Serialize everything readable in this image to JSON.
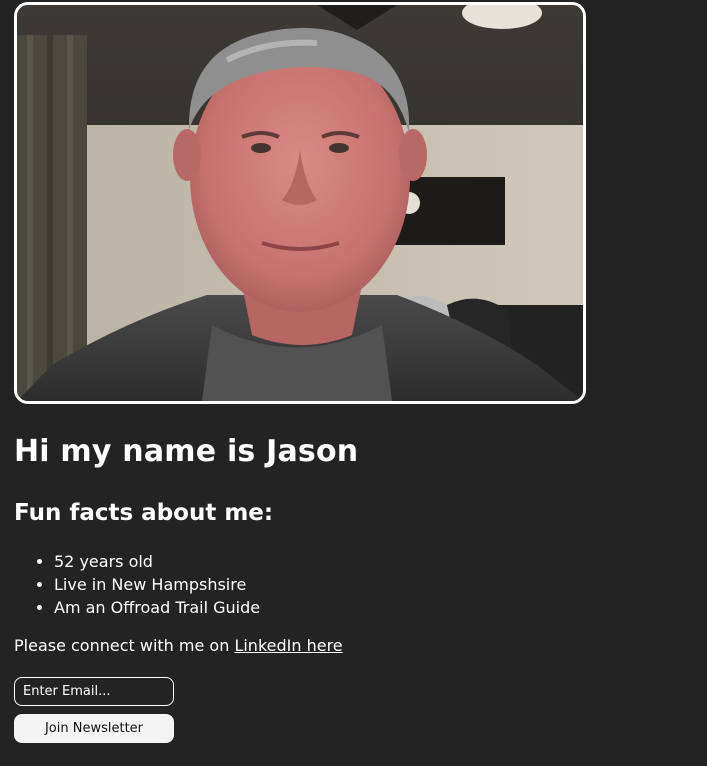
{
  "profile": {
    "photo": "portrait-photo"
  },
  "header": {
    "title": "Hi my name is Jason"
  },
  "facts": {
    "heading": "Fun facts about me:",
    "items": [
      "52 years old",
      "Live in New Hampshsire",
      "Am an Offroad Trail Guide"
    ]
  },
  "connect": {
    "text": "Please connect with me on ",
    "link_text": "LinkedIn here"
  },
  "newsletter": {
    "placeholder": "Enter Email...",
    "button_label": "Join Newsletter"
  },
  "colors": {
    "background": "#232323",
    "text": "#ffffff",
    "button_bg": "#f4f4f4"
  }
}
